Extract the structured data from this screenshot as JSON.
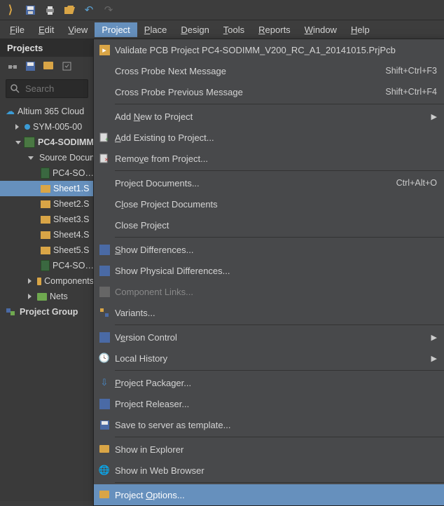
{
  "menus": {
    "file": "File",
    "edit": "Edit",
    "view": "View",
    "project": "Project",
    "place": "Place",
    "design": "Design",
    "tools": "Tools",
    "reports": "Reports",
    "window": "Window",
    "help": "Help"
  },
  "sidebar": {
    "title": "Projects",
    "search_placeholder": "Search",
    "cloud": "Altium 365 Cloud",
    "items": {
      "sym": "SYM-005-00",
      "prj": "PC4-SODIMM",
      "src": "Source Documents",
      "top": "PC4-SO…",
      "sh1": "Sheet1.S",
      "sh2": "Sheet2.S",
      "sh3": "Sheet3.S",
      "sh4": "Sheet4.S",
      "sh5": "Sheet5.S",
      "pcb": "PC4-SO…",
      "comp": "Components",
      "nets": "Nets",
      "grp": "Project Group"
    }
  },
  "dd": {
    "validate": "Validate PCB Project PC4-SODIMM_V200_RC_A1_20141015.PrjPcb",
    "cpn": "Cross Probe Next Message",
    "cpn_sc": "Shift+Ctrl+F3",
    "cpp": "Cross Probe Previous Message",
    "cpp_sc": "Shift+Ctrl+F4",
    "addnew": "Add New to Project",
    "addex": "Add Existing to Project...",
    "remove": "Remove from Project...",
    "pdocs": "Project Documents...",
    "pdocs_sc": "Ctrl+Alt+O",
    "cpd": "Close Project Documents",
    "cp": "Close Project",
    "sd": "Show Differences...",
    "spd": "Show Physical Differences...",
    "cl": "Component Links...",
    "var": "Variants...",
    "vc": "Version Control",
    "lh": "Local History",
    "pp": "Project Packager...",
    "pr": "Project Releaser...",
    "sst": "Save to server as template...",
    "sie": "Show in Explorer",
    "swb": "Show in Web Browser",
    "po": "Project Options..."
  }
}
